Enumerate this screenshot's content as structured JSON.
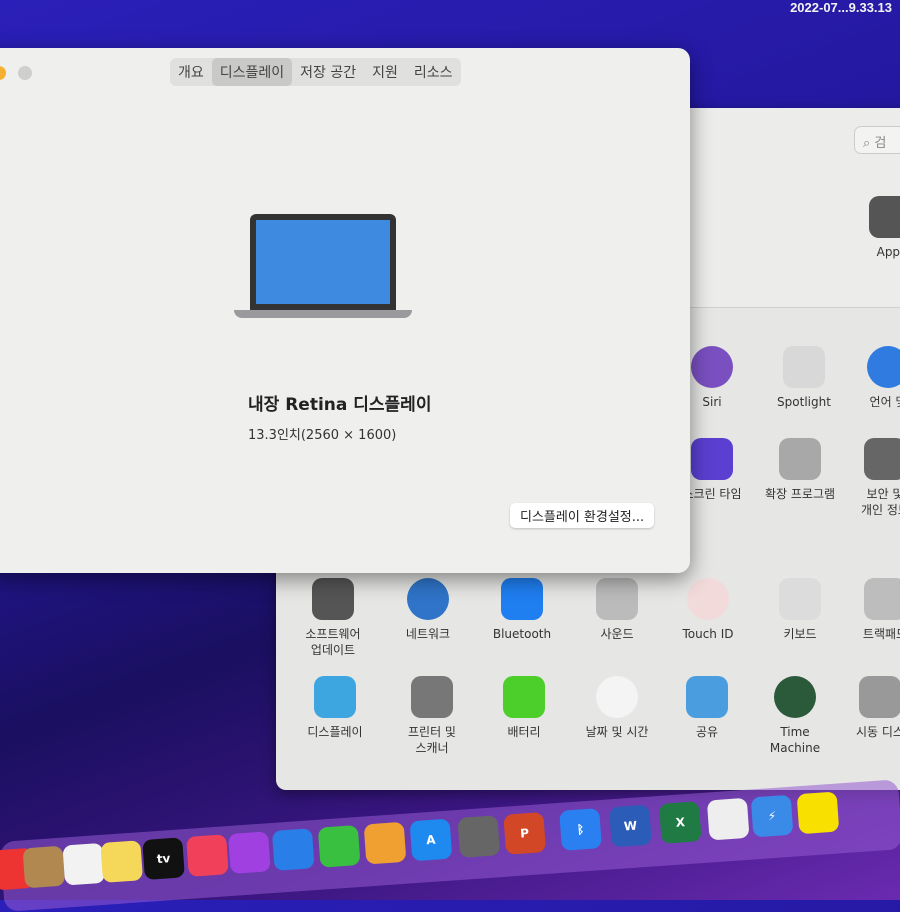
{
  "timestamp": "2022-07...9.33.13",
  "about": {
    "tabs": [
      "개요",
      "디스플레이",
      "저장 공간",
      "지원",
      "리소스"
    ],
    "selected_tab": "디스플레이",
    "display_name": "내장 Retina 디스플레이",
    "display_spec": "13.3인치(2560 × 1600)",
    "prefs_button": "디스플레이 환경설정..."
  },
  "prefs": {
    "search_placeholder": "검",
    "apple_id_label": "Appl",
    "items": [
      {
        "label": "Siri",
        "icon": "siri-icon",
        "color": "#7a4fc0"
      },
      {
        "label": "Spotlight",
        "icon": "magnifier-icon",
        "color": "#d8d8d8"
      },
      {
        "label": "언어 및",
        "icon": "flag-globe-icon",
        "color": "#2f7be0"
      },
      {
        "label": "스크린 타임",
        "icon": "hourglass-icon",
        "color": "#5a3fd0"
      },
      {
        "label": "확장 프로그램",
        "icon": "puzzle-icon",
        "color": "#a8a8a8"
      },
      {
        "label": "보안 및\n개인 정보",
        "icon": "house-lock-icon",
        "color": "#666"
      },
      {
        "label": "소프트웨어\n업데이트",
        "icon": "gear-icon",
        "color": "#555"
      },
      {
        "label": "네트워크",
        "icon": "globe-icon",
        "color": "#2f74c8"
      },
      {
        "label": "Bluetooth",
        "icon": "bluetooth-icon",
        "color": "#1f7ef0"
      },
      {
        "label": "사운드",
        "icon": "speaker-icon",
        "color": "#bbb"
      },
      {
        "label": "Touch ID",
        "icon": "fingerprint-icon",
        "color": "#f2dada"
      },
      {
        "label": "키보드",
        "icon": "keyboard-icon",
        "color": "#dcdcdc"
      },
      {
        "label": "트랙패드",
        "icon": "trackpad-icon",
        "color": "#bdbdbd"
      },
      {
        "label": "디스플레이",
        "icon": "display-icon",
        "color": "#3da6e0"
      },
      {
        "label": "프린터 및\n스캐너",
        "icon": "printer-icon",
        "color": "#777"
      },
      {
        "label": "배터리",
        "icon": "battery-icon",
        "color": "#4ccf2a"
      },
      {
        "label": "날짜 및 시간",
        "icon": "clock-icon",
        "color": "#f4f4f4"
      },
      {
        "label": "공유",
        "icon": "folder-icon",
        "color": "#4a9ee0"
      },
      {
        "label": "Time\nMachine",
        "icon": "time-machine-icon",
        "color": "#2b5a3a"
      },
      {
        "label": "시동 디스",
        "icon": "disk-icon",
        "color": "#999"
      }
    ]
  },
  "dock": [
    {
      "name": "calendar",
      "icon": "calendar-icon",
      "color": "#e33"
    },
    {
      "name": "contacts",
      "icon": "contacts-icon",
      "color": "#b08850"
    },
    {
      "name": "reminders",
      "icon": "reminders-icon",
      "color": "#f2f2f2"
    },
    {
      "name": "notes",
      "icon": "notes-icon",
      "color": "#f5d75a"
    },
    {
      "name": "tv",
      "label": "tv",
      "icon": "apple-tv-icon",
      "color": "#111"
    },
    {
      "name": "music",
      "icon": "music-icon",
      "color": "#f0405a"
    },
    {
      "name": "podcasts",
      "icon": "podcasts-icon",
      "color": "#a040e0"
    },
    {
      "name": "keynote",
      "icon": "keynote-icon",
      "color": "#2a7ee8"
    },
    {
      "name": "numbers",
      "icon": "numbers-icon",
      "color": "#3ac040"
    },
    {
      "name": "pages",
      "icon": "pages-icon",
      "color": "#f0a030"
    },
    {
      "name": "app-store",
      "label": "A",
      "icon": "app-store-icon",
      "color": "#1e8af0"
    },
    {
      "name": "system-preferences",
      "icon": "gear-icon",
      "color": "#666"
    },
    {
      "name": "powerpoint",
      "label": "P",
      "icon": "powerpoint-icon",
      "color": "#d24726"
    },
    {
      "name": "bluetooth-file-exchange",
      "label": "ᛒ",
      "icon": "bluetooth-icon",
      "color": "#2a80f0"
    },
    {
      "name": "word",
      "label": "W",
      "icon": "word-icon",
      "color": "#2b5cb8"
    },
    {
      "name": "excel",
      "label": "X",
      "icon": "excel-icon",
      "color": "#1f7a44"
    },
    {
      "name": "microsoft-autoupdate",
      "icon": "microsoft-icon",
      "color": "#eee"
    },
    {
      "name": "thunderbolt-app",
      "label": "⚡",
      "icon": "lightning-icon",
      "color": "#3a8ae8"
    },
    {
      "name": "kakaotalk",
      "icon": "chat-icon",
      "color": "#f8e000"
    }
  ]
}
